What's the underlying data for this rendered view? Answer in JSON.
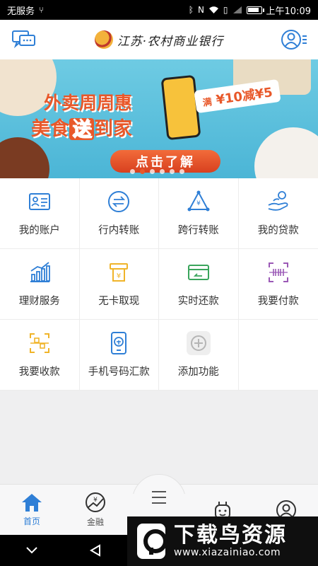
{
  "status_bar": {
    "carrier": "无服务",
    "time": "上午10:09",
    "battery_level": 0.85
  },
  "header": {
    "logo_text": "江苏·农村商业银行",
    "icons": [
      "message-icon",
      "user-menu-icon"
    ]
  },
  "banner": {
    "headline": "外卖周周惠",
    "subline_prefix": "美食",
    "subline_highlight": "送",
    "subline_suffix": "到家",
    "promo_prefix": "满",
    "promo_amount": "¥10减¥5",
    "cta": "点击了解",
    "dots_total": 6,
    "dot_active": 1
  },
  "grid": {
    "items": [
      {
        "label": "我的账户",
        "icon": "account-card-icon",
        "color": "#2f7fd6"
      },
      {
        "label": "行内转账",
        "icon": "transfer-icon",
        "color": "#2f7fd6"
      },
      {
        "label": "跨行转账",
        "icon": "interbank-transfer-icon",
        "color": "#2f7fd6"
      },
      {
        "label": "我的贷款",
        "icon": "loan-icon",
        "color": "#2f7fd6"
      },
      {
        "label": "理财服务",
        "icon": "wealth-chart-icon",
        "color": "#2f7fd6"
      },
      {
        "label": "无卡取现",
        "icon": "cardless-cash-icon",
        "color": "#f0b429"
      },
      {
        "label": "实时还款",
        "icon": "repayment-card-icon",
        "color": "#3aa55c"
      },
      {
        "label": "我要付款",
        "icon": "pay-scan-icon",
        "color": "#9b59b6"
      },
      {
        "label": "我要收款",
        "icon": "receive-scan-icon",
        "color": "#f0b429"
      },
      {
        "label": "手机号码汇款",
        "icon": "phone-remit-icon",
        "color": "#2f7fd6"
      },
      {
        "label": "添加功能",
        "icon": "add-function-icon",
        "color": "#b5b5b5"
      },
      {
        "label": "",
        "icon": "",
        "color": ""
      }
    ]
  },
  "tabbar": {
    "tabs": [
      {
        "label": "首页",
        "icon": "home-icon",
        "active": true
      },
      {
        "label": "金融",
        "icon": "finance-icon",
        "active": false
      },
      {
        "label": "",
        "icon": "menu-icon",
        "active": false
      },
      {
        "label": "",
        "icon": "life-icon",
        "active": false
      },
      {
        "label": "",
        "icon": "profile-icon",
        "active": false
      }
    ]
  },
  "watermark": {
    "title": "下载鸟资源",
    "url": "www.xiazainiao.com"
  }
}
